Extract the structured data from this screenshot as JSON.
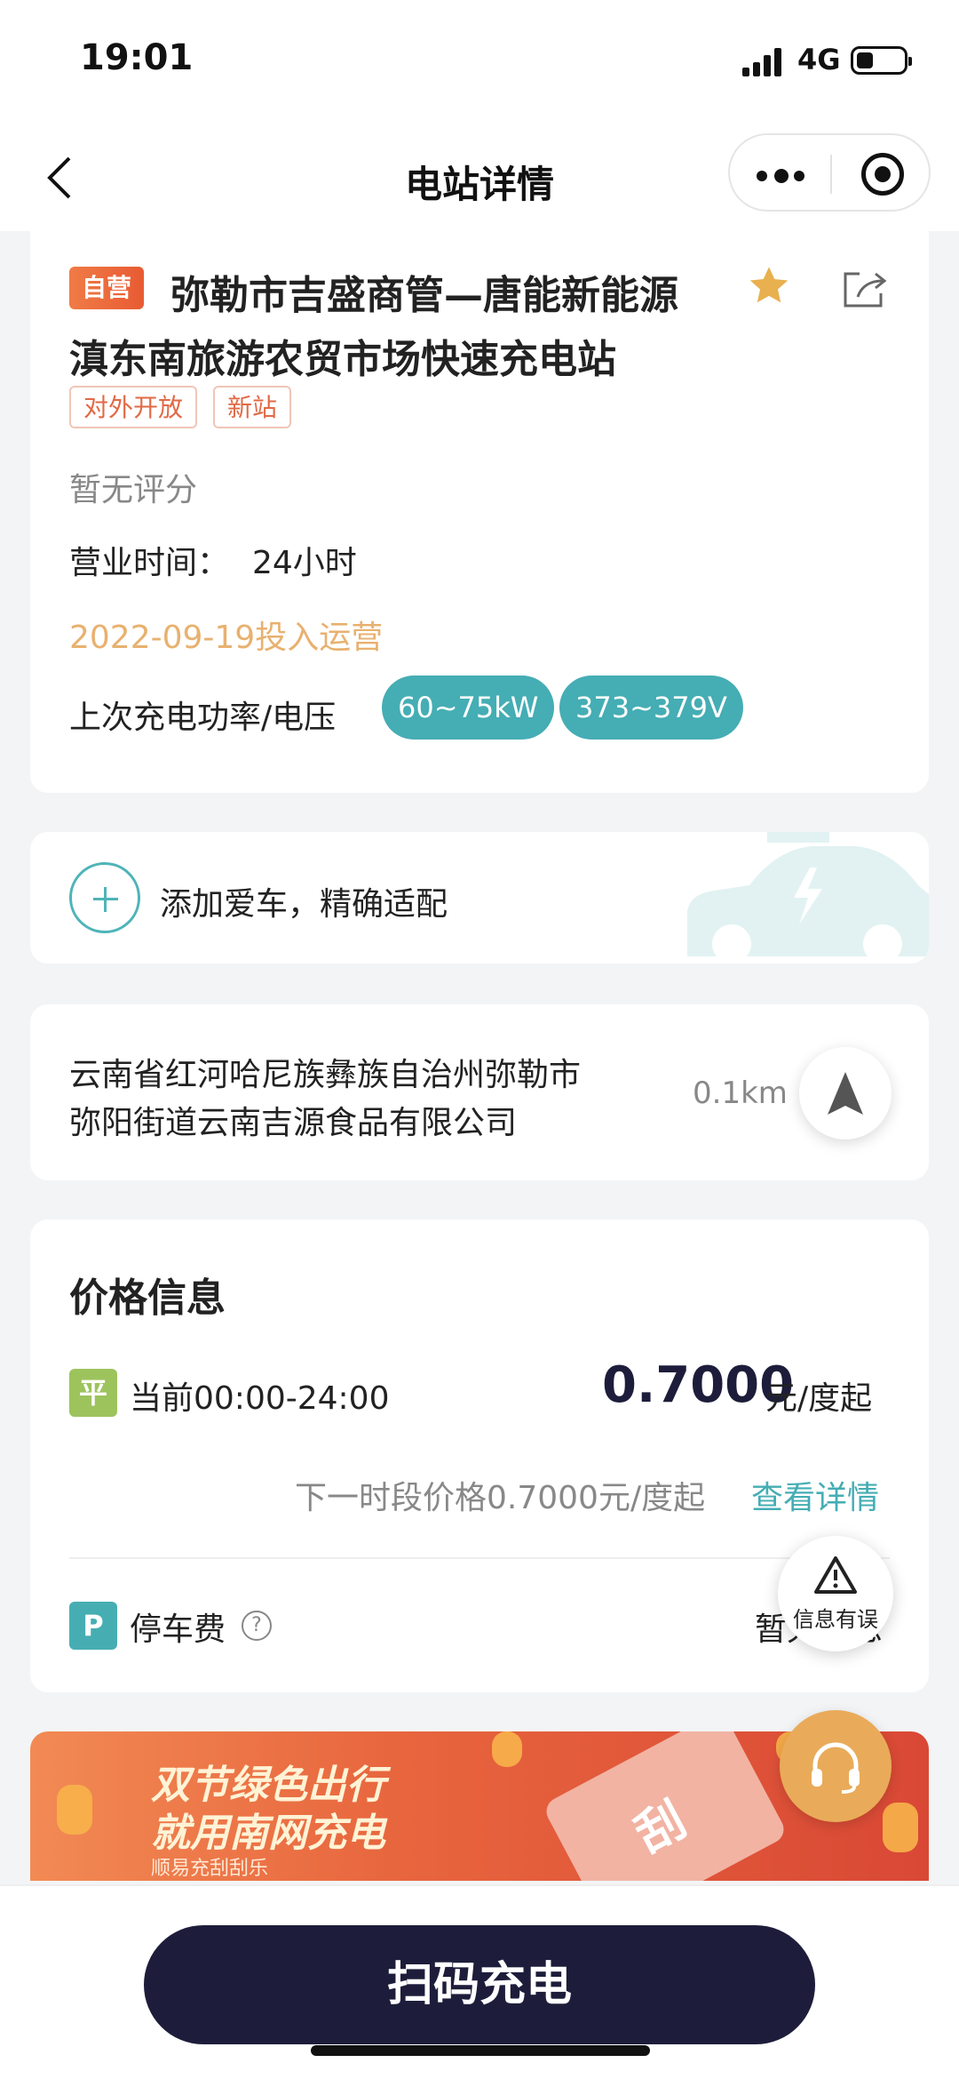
{
  "status_bar": {
    "time": "19:01",
    "network": "4G",
    "battery_level_percent": 35
  },
  "nav": {
    "title": "电站详情"
  },
  "station": {
    "self_badge": "自营",
    "name_line1": "弥勒市吉盛商管—唐能新能源",
    "name_line2": "滇东南旅游农贸市场快速充电站",
    "tags": [
      "对外开放",
      "新站"
    ],
    "rating": "暂无评分",
    "hours_label": "营业时间：",
    "hours_value": "24小时",
    "operation_date": "2022-09-19投入运营",
    "last_charge_label": "上次充电功率/电压",
    "power": "60~75kW",
    "voltage": "373~379V",
    "favorite_color": "#e8b04e"
  },
  "car": {
    "text": "添加爱车，精确适配"
  },
  "address": {
    "line1": "云南省红河哈尼族彝族自治州弥勒市",
    "line2": "弥阳街道云南吉源食品有限公司",
    "distance": "0.1km"
  },
  "price": {
    "title": "价格信息",
    "flat_badge": "平",
    "current_period": "当前00:00-24:00",
    "value": "0.7000",
    "unit": "元/度起",
    "next_price": "下一时段价格0.7000元/度起",
    "detail_link": "查看详情",
    "parking_badge": "P",
    "parking_label": "停车费",
    "parking_value": "暂无信息"
  },
  "error_report": {
    "label": "信息有误"
  },
  "banner": {
    "line1": "双节绿色出行",
    "line2": "就用南网充电",
    "line3": "顺易充刮刮乐",
    "ticket_text": "刮"
  },
  "bottom": {
    "scan_button": "扫码充电"
  },
  "colors": {
    "accent": "#45adb4",
    "dark": "#1d1d3b",
    "orange": "#e85b33"
  }
}
